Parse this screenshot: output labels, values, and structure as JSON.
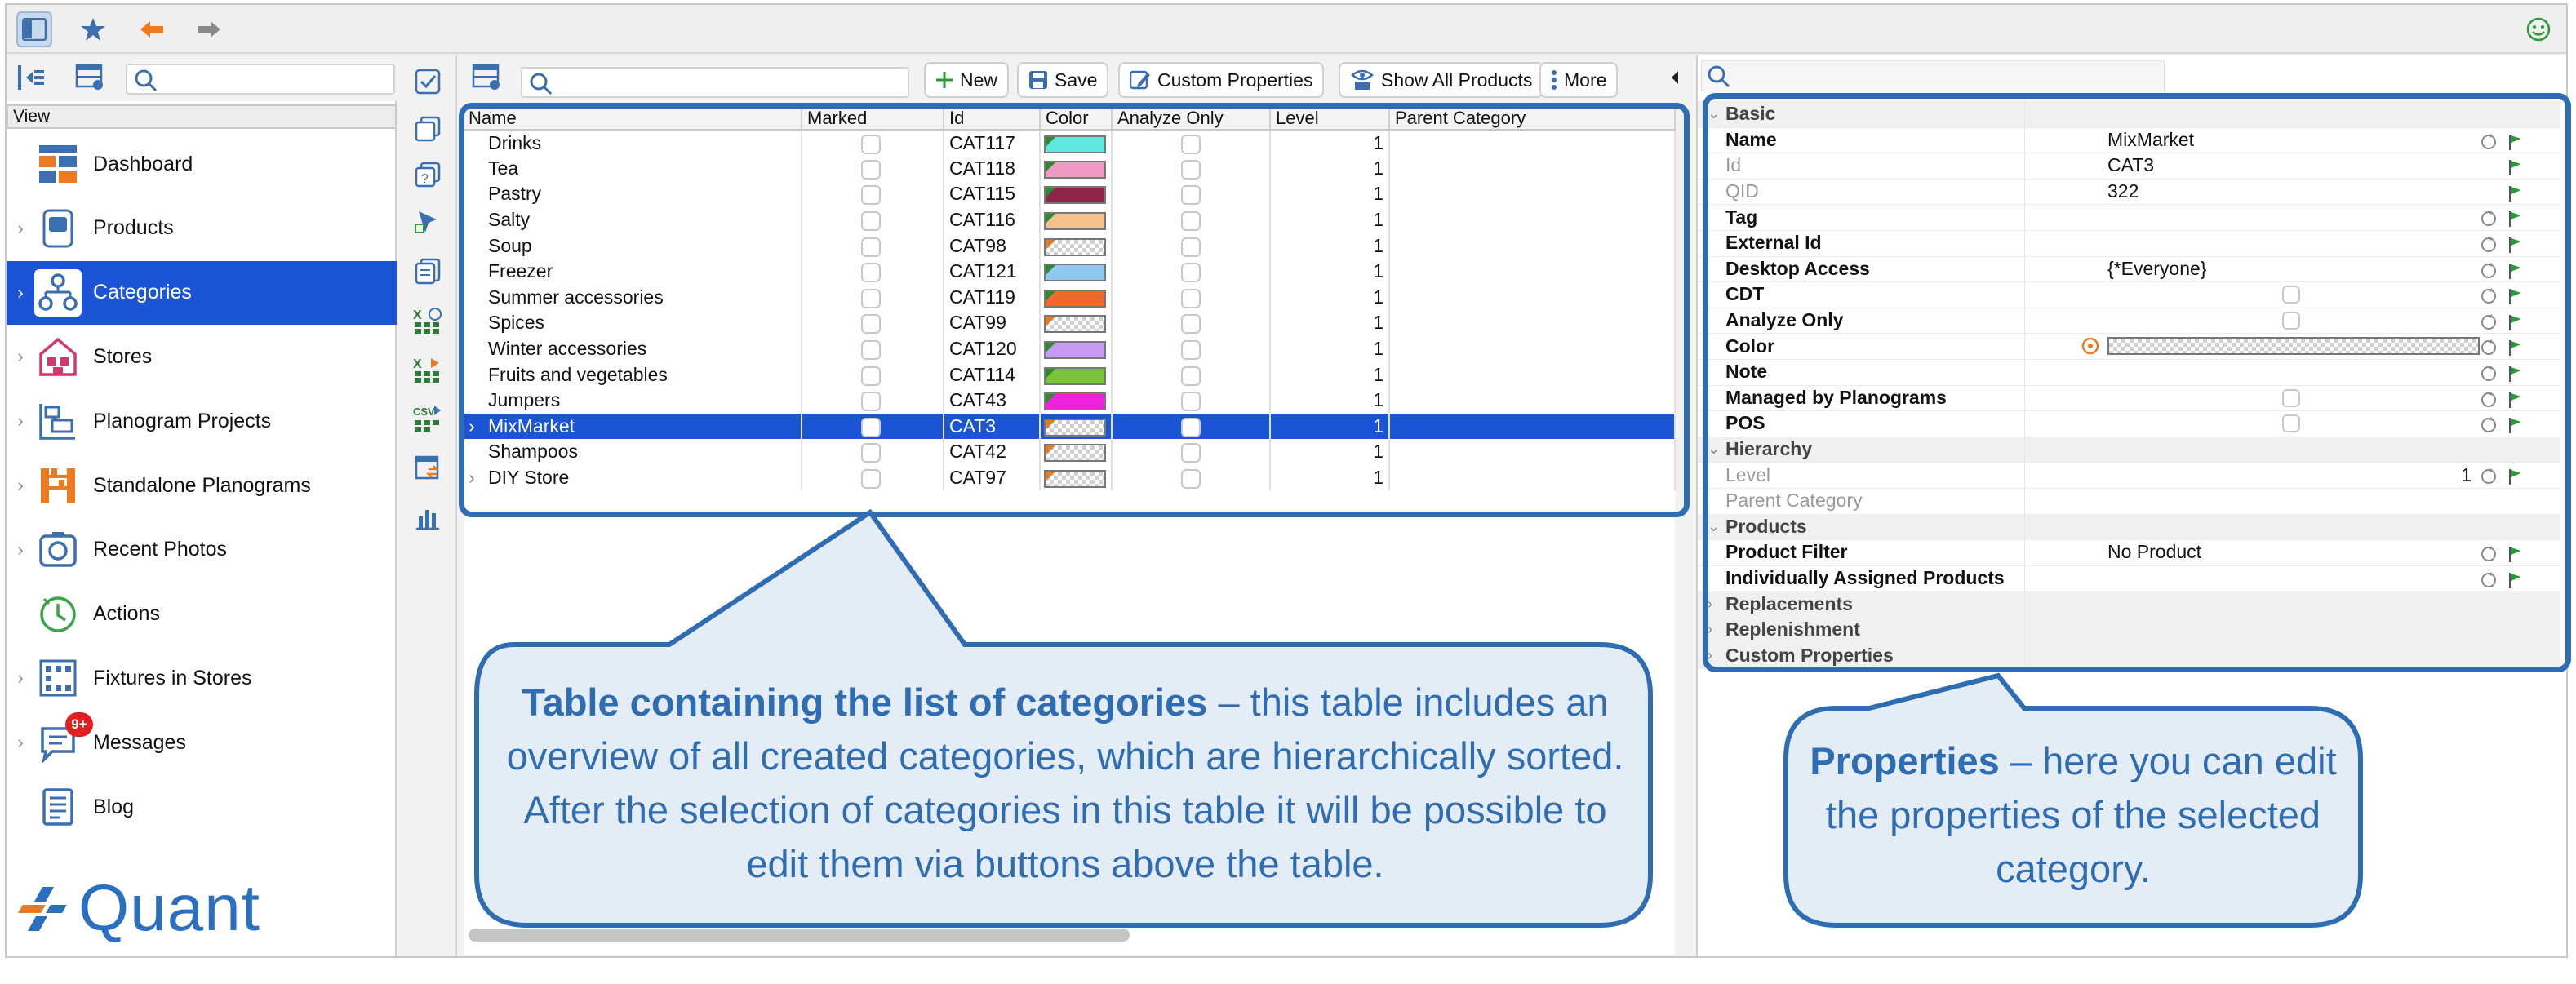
{
  "colors": {
    "accent": "#2f6db3",
    "selection": "#1c54d6",
    "callout_fill": "#e4ecf5"
  },
  "topbar": {
    "icons": [
      "sidebar-toggle-icon",
      "star-icon",
      "back-arrow-icon",
      "forward-arrow-icon",
      "smiley-icon"
    ]
  },
  "leftnav": {
    "view_label": "View",
    "items": [
      {
        "label": "Dashboard",
        "icon": "dashboard-icon",
        "chevron": false
      },
      {
        "label": "Products",
        "icon": "products-icon",
        "chevron": true
      },
      {
        "label": "Categories",
        "icon": "categories-icon",
        "chevron": true,
        "selected": true
      },
      {
        "label": "Stores",
        "icon": "stores-icon",
        "chevron": true
      },
      {
        "label": "Planogram Projects",
        "icon": "planogram-projects-icon",
        "chevron": true
      },
      {
        "label": "Standalone Planograms",
        "icon": "standalone-planograms-icon",
        "chevron": true
      },
      {
        "label": "Recent Photos",
        "icon": "camera-icon",
        "chevron": true
      },
      {
        "label": "Actions",
        "icon": "actions-icon",
        "chevron": false
      },
      {
        "label": "Fixtures in Stores",
        "icon": "fixtures-icon",
        "chevron": true
      },
      {
        "label": "Messages",
        "icon": "messages-icon",
        "chevron": true,
        "badge": "9+"
      },
      {
        "label": "Blog",
        "icon": "blog-icon",
        "chevron": false
      }
    ],
    "logo_text": "Quant"
  },
  "toolbar": {
    "new_label": "New",
    "save_label": "Save",
    "custom_properties_label": "Custom Properties",
    "show_all_products_label": "Show All Products",
    "more_label": "More"
  },
  "table": {
    "columns": [
      "Name",
      "Marked",
      "Id",
      "Color",
      "Analyze Only",
      "Level",
      "Parent Category"
    ],
    "rows": [
      {
        "name": "Drinks",
        "id": "CAT117",
        "color": "#5ee8e0",
        "level": "1",
        "corner": "green"
      },
      {
        "name": "Tea",
        "id": "CAT118",
        "color": "#ef9ac4",
        "level": "1",
        "corner": "green"
      },
      {
        "name": "Pastry",
        "id": "CAT115",
        "color": "#8e2448",
        "level": "1",
        "corner": "green"
      },
      {
        "name": "Salty",
        "id": "CAT116",
        "color": "#f5c28e",
        "level": "1",
        "corner": "green"
      },
      {
        "name": "Soup",
        "id": "CAT98",
        "color": "none",
        "level": "1",
        "corner": "orange"
      },
      {
        "name": "Freezer",
        "id": "CAT121",
        "color": "#8fc8f0",
        "level": "1",
        "corner": "green"
      },
      {
        "name": "Summer accessories",
        "id": "CAT119",
        "color": "#ee6a2a",
        "level": "1",
        "corner": "green"
      },
      {
        "name": "Spices",
        "id": "CAT99",
        "color": "none",
        "level": "1",
        "corner": "orange"
      },
      {
        "name": "Winter accessories",
        "id": "CAT120",
        "color": "#c69af0",
        "level": "1",
        "corner": "green"
      },
      {
        "name": "Fruits and vegetables",
        "id": "CAT114",
        "color": "#7cc23c",
        "level": "1",
        "corner": "green"
      },
      {
        "name": "Jumpers",
        "id": "CAT43",
        "color": "#ee22dd",
        "level": "1",
        "corner": "green"
      },
      {
        "name": "MixMarket",
        "id": "CAT3",
        "color": "none",
        "level": "1",
        "corner": "orange",
        "selected": true,
        "chevron": true
      },
      {
        "name": "Shampoos",
        "id": "CAT42",
        "color": "none",
        "level": "1",
        "corner": "orange"
      },
      {
        "name": "DIY Store",
        "id": "CAT97",
        "color": "none",
        "level": "1",
        "corner": "orange",
        "chevron": true
      }
    ]
  },
  "properties": {
    "rows": [
      {
        "type": "group",
        "label": "Basic"
      },
      {
        "label": "Name",
        "value": "MixMarket"
      },
      {
        "label": "Id",
        "value": "CAT3",
        "muted": true
      },
      {
        "label": "QID",
        "value": "322",
        "muted": true
      },
      {
        "label": "Tag",
        "value": ""
      },
      {
        "label": "External Id",
        "value": ""
      },
      {
        "label": "Desktop Access",
        "value": "{*Everyone}"
      },
      {
        "label": "CDT",
        "checkbox": true
      },
      {
        "label": "Analyze Only",
        "checkbox": true
      },
      {
        "label": "Color",
        "swatch": true
      },
      {
        "label": "Note",
        "value": ""
      },
      {
        "label": "Managed by Planograms",
        "checkbox": true
      },
      {
        "label": "POS",
        "checkbox": true
      },
      {
        "type": "group",
        "label": "Hierarchy"
      },
      {
        "label": "Level",
        "value": "1",
        "muted": true,
        "right": true
      },
      {
        "label": "Parent Category",
        "value": "",
        "muted": true
      },
      {
        "type": "group",
        "label": "Products"
      },
      {
        "label": "Product Filter",
        "value": "No Product"
      },
      {
        "label": "Individually Assigned Products",
        "value": ""
      },
      {
        "type": "group",
        "label": "Replacements"
      },
      {
        "type": "group",
        "label": "Replenishment"
      },
      {
        "type": "group",
        "label": "Custom Properties"
      }
    ]
  },
  "callouts": {
    "table_title": "Table containing the list of categories",
    "table_body": " – this table includes an overview of all created categories, which are hierarchically sorted. After the selection of categories in this table it will be possible to edit them via buttons above the table.",
    "props_title": "Properties",
    "props_body": " – here you can edit the properties of the selected category."
  }
}
